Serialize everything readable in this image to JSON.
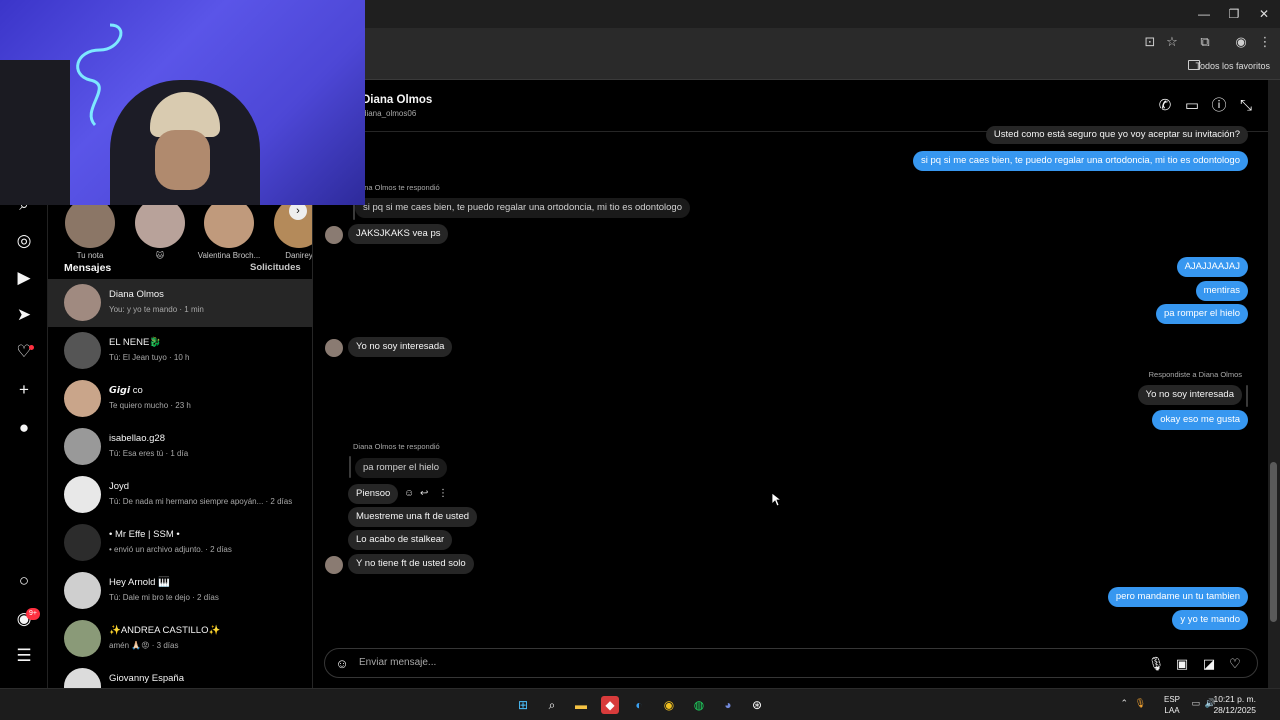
{
  "browser": {
    "bookmarks_label": "Todos los favoritos"
  },
  "inbox": {
    "stories": [
      {
        "label": "Tu nota"
      },
      {
        "label": "🐱"
      },
      {
        "label": "Valentina Broch..."
      },
      {
        "label": "Danirey"
      }
    ],
    "title": "Mensajes",
    "requests_label": "Solicitudes",
    "conversations": [
      {
        "name": "Diana Olmos",
        "preview": "You: y yo te mando · 1 min",
        "active": true
      },
      {
        "name": "EL NENE🐉",
        "preview": "Tú: El Jean tuyo · 10 h"
      },
      {
        "name": "𝙂𝙞𝙜𝙞 co",
        "preview": "Te quiero mucho · 23 h"
      },
      {
        "name": "isabellao.g28",
        "preview": "Tú: Esa eres tú · 1 día"
      },
      {
        "name": "Joyd",
        "preview": "Tú: De nada mi hermano siempre apoyán... · 2 días"
      },
      {
        "name": "• Mr Effe | SSM •",
        "preview": "• envió un archivo adjunto. · 2 días"
      },
      {
        "name": "Hey Arnold 🎹",
        "preview": "Tú: Dale mi bro te dejo · 2 días"
      },
      {
        "name": "✨ANDREA CASTILLO✨",
        "preview": "amén 🙏🏻😡 · 3 días"
      },
      {
        "name": "Giovanny España",
        "preview": ""
      }
    ]
  },
  "chat": {
    "name": "Diana Olmos",
    "username": "diana_olmos06",
    "messages": {
      "m1": "Usted como está seguro que yo voy aceptar su invitación?",
      "m2": "si pq si me caes bien, te puedo regalar una ortodoncia, mi tio es odontologo",
      "reply1_meta": "Diana Olmos te respondió",
      "reply1_quote": "si pq si me caes bien, te puedo regalar una ortodoncia, mi tio es odontologo",
      "m3": "JAKSJKAKS vea ps",
      "m4": "AJAJJAAJAJ",
      "m5": "mentiras",
      "m6": "pa romper el hielo",
      "m7": "Yo no soy interesada",
      "reply2_meta": "Respondiste a Diana Olmos",
      "reply2_quote": "Yo no soy interesada",
      "m8": "okay eso me gusta",
      "reply3_meta": "Diana Olmos te respondió",
      "reply3_quote": "pa romper el hielo",
      "m9": "Piensoo",
      "m10": "Muestreme una ft de usted",
      "m11": "Lo acabo de stalkear",
      "m12": "Y no tiene ft de usted solo",
      "m13": "pero mandame un tu tambien",
      "m14": "y yo te mando"
    },
    "composer_placeholder": "Enviar mensaje..."
  },
  "taskbar": {
    "lang_line1": "ESP",
    "lang_line2": "LAA",
    "time": "10:21 p. m.",
    "date": "28/12/2025",
    "notif_count": "9+"
  },
  "colors": {
    "accent": "#3797f0",
    "incoming_bubble": "#262626",
    "badge": "#ff3040"
  }
}
